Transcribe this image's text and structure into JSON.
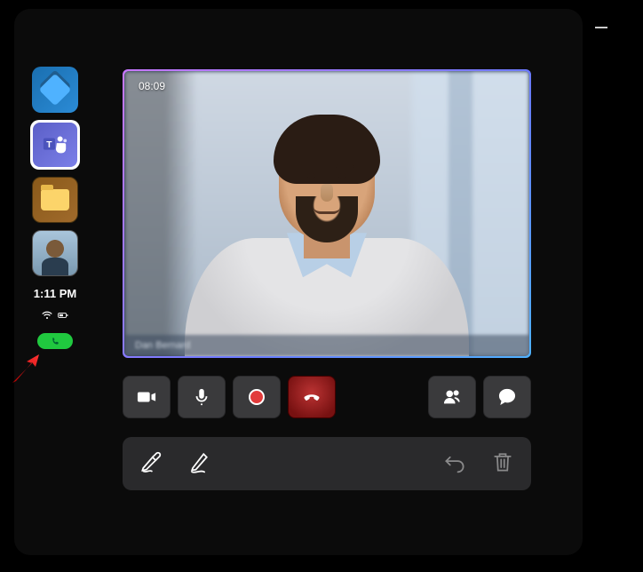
{
  "window": {
    "minimize_icon": "minimize"
  },
  "dock": {
    "items": [
      {
        "name": "app-launcher",
        "icon": "diamond-icon"
      },
      {
        "name": "teams",
        "icon": "teams-icon",
        "active": true
      },
      {
        "name": "files",
        "icon": "folder-icon"
      },
      {
        "name": "user-avatar",
        "icon": "avatar-icon"
      }
    ]
  },
  "status": {
    "clock": "1:11 PM",
    "wifi_icon": "wifi-icon",
    "battery_icon": "battery-icon",
    "call_pill_icon": "phone-icon"
  },
  "pointer": {
    "icon": "red-arrow"
  },
  "call": {
    "timer": "08:09",
    "participant_caption": "Dan Bernard"
  },
  "controls": {
    "camera_label": "Camera",
    "mic_label": "Mic",
    "record_label": "Record",
    "hangup_label": "Leave",
    "people_label": "People",
    "chat_label": "Chat"
  },
  "ink": {
    "highlighter_label": "Highlighter",
    "pen_label": "Pen",
    "undo_label": "Undo",
    "delete_label": "Delete"
  }
}
